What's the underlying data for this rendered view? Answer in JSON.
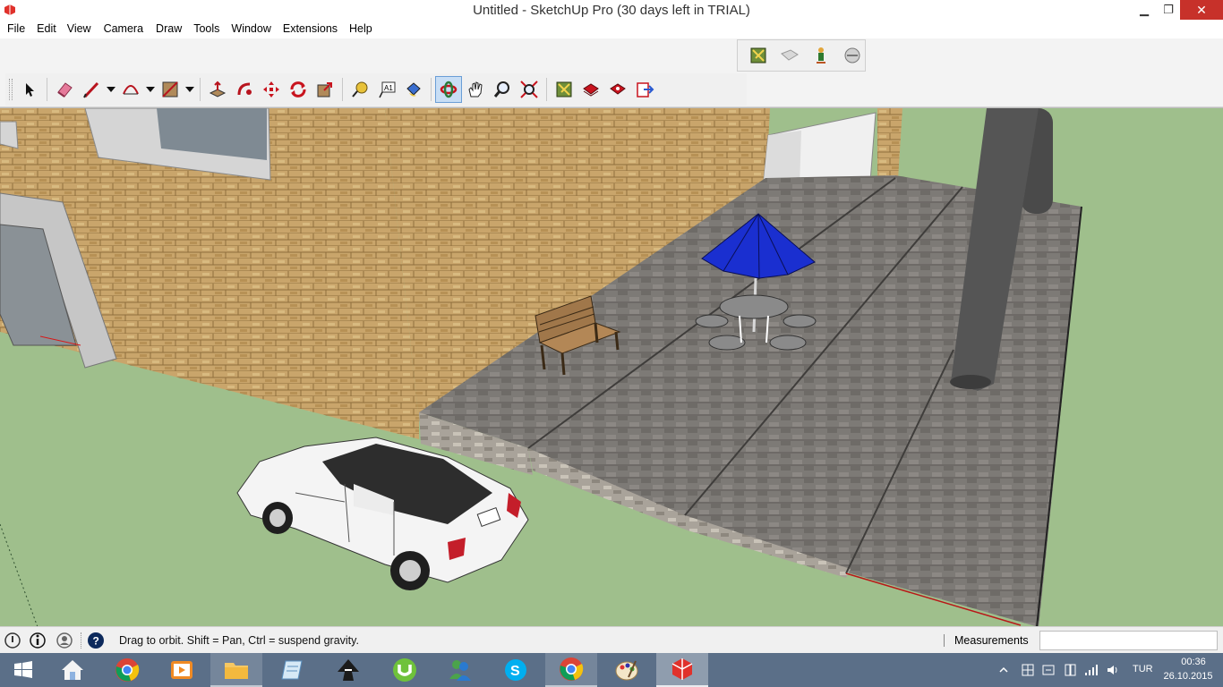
{
  "window": {
    "title": "Untitled - SketchUp Pro (30 days left in TRIAL)",
    "minimize_symbol": "▁",
    "maximize_symbol": "❐",
    "close_symbol": "✕"
  },
  "menu": [
    {
      "label": "File"
    },
    {
      "label": "Edit"
    },
    {
      "label": "View"
    },
    {
      "label": "Camera"
    },
    {
      "label": "Draw"
    },
    {
      "label": "Tools"
    },
    {
      "label": "Window"
    },
    {
      "label": "Extensions"
    },
    {
      "label": "Help"
    }
  ],
  "small_toolbar": {
    "icons": [
      "3d-warehouse-icon",
      "share-model-icon",
      "extension-warehouse-icon",
      "layout-icon"
    ]
  },
  "main_toolbar": {
    "icons": [
      "select-icon",
      "eraser-icon",
      "line-icon",
      "arc-icon",
      "rectangle-icon",
      "push-pull-icon",
      "follow-me-icon",
      "move-icon",
      "rotate-icon",
      "scale-icon",
      "tape-measure-icon",
      "text-icon",
      "paint-bucket-icon",
      "orbit-icon",
      "pan-icon",
      "zoom-icon",
      "zoom-extents-icon",
      "3d-warehouse-icon",
      "extension-warehouse-icon",
      "component-icon",
      "send-to-layout-icon"
    ],
    "active_tool": "orbit-icon"
  },
  "status": {
    "hint": "Drag to orbit. Shift = Pan, Ctrl = suspend gravity.",
    "measurements_label": "Measurements",
    "measurements_value": ""
  },
  "taskbar": {
    "apps": [
      "start-icon",
      "file-explorer-home-icon",
      "chrome-icon",
      "media-player-icon",
      "file-explorer-icon",
      "notepad-icon",
      "inkscape-icon",
      "utorrent-icon",
      "messenger-icon",
      "skype-icon",
      "chrome-icon",
      "paint-icon",
      "sketchup-icon"
    ],
    "tray": {
      "language": "TUR",
      "time": "00:36",
      "date": "26.10.2015"
    }
  },
  "colors": {
    "close_button": "#c7312a",
    "taskbar": "#5b6f88",
    "ground": "#9fbf8c",
    "brick": "#c9a56b",
    "umbrella": "#1a2fd0",
    "active_tool_bg": "#c8def5"
  }
}
